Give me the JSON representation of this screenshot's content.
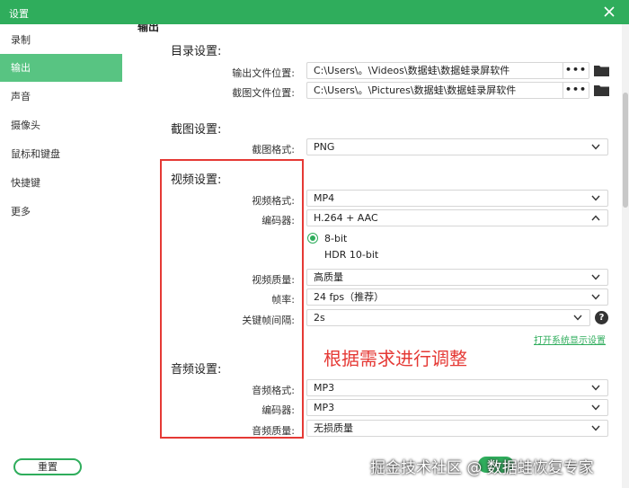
{
  "window": {
    "title": "设置"
  },
  "sidebar": {
    "items": [
      {
        "label": "录制"
      },
      {
        "label": "输出"
      },
      {
        "label": "声音"
      },
      {
        "label": "摄像头"
      },
      {
        "label": "鼠标和键盘"
      },
      {
        "label": "快捷键"
      },
      {
        "label": "更多"
      }
    ],
    "active_index": 1,
    "reset_label": "重置"
  },
  "content": {
    "cut_heading": "输出",
    "directory": {
      "title": "目录设置:",
      "output_label": "输出文件位置:",
      "output_path": "C:\\Users\\。\\Videos\\数据蛙\\数据蛙录屏软件",
      "screenshot_label": "截图文件位置:",
      "screenshot_path": "C:\\Users\\。\\Pictures\\数据蛙\\数据蛙录屏软件",
      "browse_label": "•••"
    },
    "screenshot": {
      "title": "截图设置:",
      "format_label": "截图格式:",
      "format_value": "PNG"
    },
    "video": {
      "title": "视频设置:",
      "format_label": "视频格式:",
      "format_value": "MP4",
      "encoder_label": "编码器:",
      "encoder_value": "H.264 + AAC",
      "bit_8": "8-bit",
      "bit_hdr": "HDR 10-bit",
      "quality_label": "视频质量:",
      "quality_value": "高质量",
      "fps_label": "帧率:",
      "fps_value": "24 fps（推荐）",
      "keyframe_label": "关键帧间隔:",
      "keyframe_value": "2s",
      "help": "?",
      "display_link": "打开系统显示设置"
    },
    "audio": {
      "title": "音频设置:",
      "format_label": "音频格式:",
      "format_value": "MP3",
      "encoder_label": "编码器:",
      "encoder_value": "MP3",
      "quality_label": "音频质量:",
      "quality_value": "无损质量"
    },
    "annotation": "根据需求进行调整"
  },
  "watermark": "掘金技术社区 @ 数据蛙恢复专家",
  "colors": {
    "accent": "#2fad5c",
    "nav_active": "#58c482",
    "annotation": "#e53935"
  }
}
